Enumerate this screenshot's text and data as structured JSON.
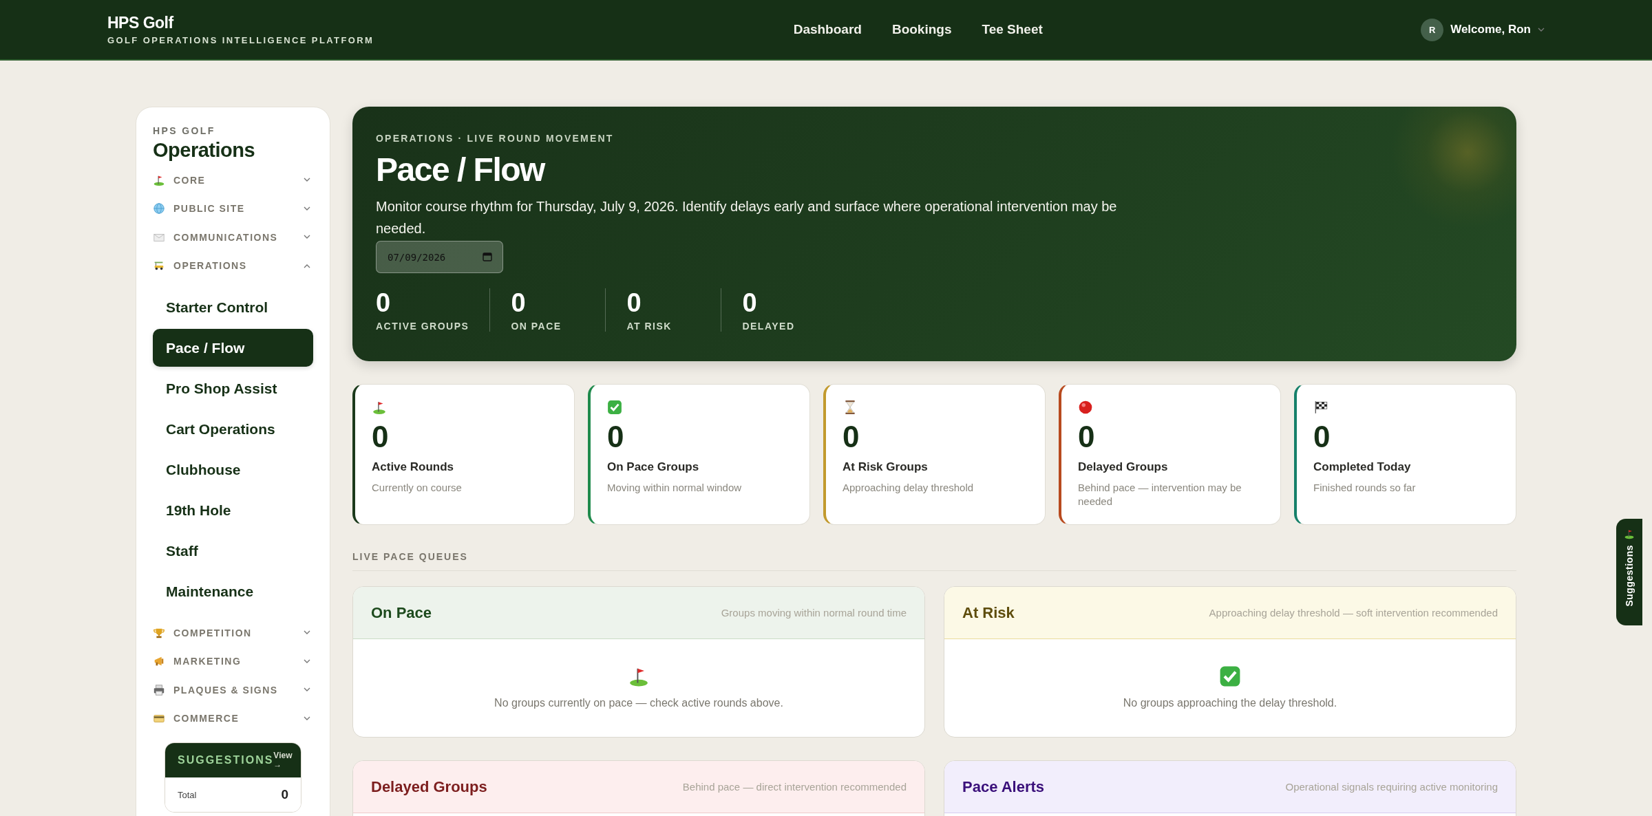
{
  "header": {
    "brand": "HPS Golf",
    "tagline": "GOLF OPERATIONS INTELLIGENCE PLATFORM",
    "nav": [
      {
        "label": "Dashboard"
      },
      {
        "label": "Bookings"
      },
      {
        "label": "Tee Sheet"
      }
    ],
    "user": {
      "initial": "R",
      "greeting": "Welcome, Ron"
    }
  },
  "sidebar": {
    "eyebrow": "HPS GOLF",
    "title": "Operations",
    "sections": [
      {
        "kind": "flag",
        "label": "CORE",
        "expanded": false
      },
      {
        "kind": "globe",
        "label": "PUBLIC SITE",
        "expanded": false
      },
      {
        "kind": "mail",
        "label": "COMMUNICATIONS",
        "expanded": false
      },
      {
        "kind": "cart",
        "label": "OPERATIONS",
        "expanded": true,
        "children": [
          {
            "label": "Starter Control",
            "selected": false
          },
          {
            "label": "Pace / Flow",
            "selected": true
          },
          {
            "label": "Pro Shop Assist",
            "selected": false
          },
          {
            "label": "Cart Operations",
            "selected": false
          },
          {
            "label": "Clubhouse",
            "selected": false
          },
          {
            "label": "19th Hole",
            "selected": false
          },
          {
            "label": "Staff",
            "selected": false
          },
          {
            "label": "Maintenance",
            "selected": false
          }
        ]
      },
      {
        "kind": "trophy",
        "label": "COMPETITION",
        "expanded": false
      },
      {
        "kind": "megaphone",
        "label": "MARKETING",
        "expanded": false
      },
      {
        "kind": "printer",
        "label": "PLAQUES & SIGNS",
        "expanded": false
      },
      {
        "kind": "card",
        "label": "COMMERCE",
        "expanded": false
      }
    ],
    "suggestions": {
      "title": "SUGGESTIONS",
      "link": "View →",
      "rows": [
        {
          "label": "Total",
          "value": "0"
        }
      ]
    }
  },
  "hero": {
    "eyebrow": "OPERATIONS · LIVE ROUND MOVEMENT",
    "title": "Pace / Flow",
    "description": "Monitor course rhythm for Thursday, July 9, 2026. Identify delays early and surface where operational intervention may be needed.",
    "date": "07/09/2026",
    "stats": [
      {
        "value": "0",
        "label": "ACTIVE GROUPS"
      },
      {
        "value": "0",
        "label": "ON PACE"
      },
      {
        "value": "0",
        "label": "AT RISK"
      },
      {
        "value": "0",
        "label": "DELAYED"
      }
    ]
  },
  "cards": [
    {
      "kind": "flag",
      "color": "#1b3a1b",
      "value": "0",
      "label": "Active Rounds",
      "sublabel": "Currently on course"
    },
    {
      "kind": "check",
      "color": "#1f8a4c",
      "value": "0",
      "label": "On Pace Groups",
      "sublabel": "Moving within normal window"
    },
    {
      "kind": "hourglass",
      "color": "#c29a2e",
      "value": "0",
      "label": "At Risk Groups",
      "sublabel": "Approaching delay threshold"
    },
    {
      "kind": "dot",
      "color": "#b84a1e",
      "value": "0",
      "label": "Delayed Groups",
      "sublabel": "Behind pace — intervention may be needed"
    },
    {
      "kind": "checkered",
      "color": "#16806a",
      "value": "0",
      "label": "Completed Today",
      "sublabel": "Finished rounds so far"
    }
  ],
  "queues": {
    "heading": "LIVE PACE QUEUES",
    "panels": [
      {
        "kind": "on_pace",
        "title": "On Pace",
        "subtitle": "Groups moving within normal round time",
        "empty_text": "No groups currently on pace — check active rounds above."
      },
      {
        "kind": "at_risk",
        "title": "At Risk",
        "subtitle": "Approaching delay threshold — soft intervention recommended",
        "empty_text": "No groups approaching the delay threshold."
      },
      {
        "kind": "delayed",
        "title": "Delayed Groups",
        "subtitle": "Behind pace — direct intervention recommended"
      },
      {
        "kind": "alerts",
        "title": "Pace Alerts",
        "subtitle": "Operational signals requiring active monitoring"
      }
    ]
  },
  "suggestions_tab": {
    "label": "Suggestions"
  }
}
